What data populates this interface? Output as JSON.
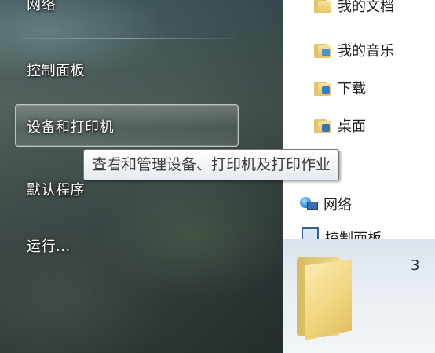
{
  "start_menu": {
    "items": [
      {
        "label": "网络"
      },
      {
        "label": "控制面板"
      },
      {
        "label": "设备和打印机"
      },
      {
        "label": "默认程序"
      },
      {
        "label": "运行..."
      }
    ]
  },
  "explorer_nav": {
    "items": [
      {
        "label": "我的文档",
        "icon": "documents-folder-icon"
      },
      {
        "label": "我的音乐",
        "icon": "music-folder-icon"
      },
      {
        "label": "下载",
        "icon": "downloads-folder-icon"
      },
      {
        "label": "桌面",
        "icon": "desktop-folder-icon"
      },
      {
        "label": "网络",
        "icon": "network-icon"
      },
      {
        "label": "控制面板",
        "icon": "control-panel-icon"
      }
    ]
  },
  "tooltip": {
    "text": "查看和管理设备、打印机及打印作业"
  },
  "details": {
    "count_text": "3"
  },
  "colors": {
    "glass_dark": "#2f3a39",
    "folder_yellow": "#f1d57f",
    "tooltip_border": "#767676"
  }
}
